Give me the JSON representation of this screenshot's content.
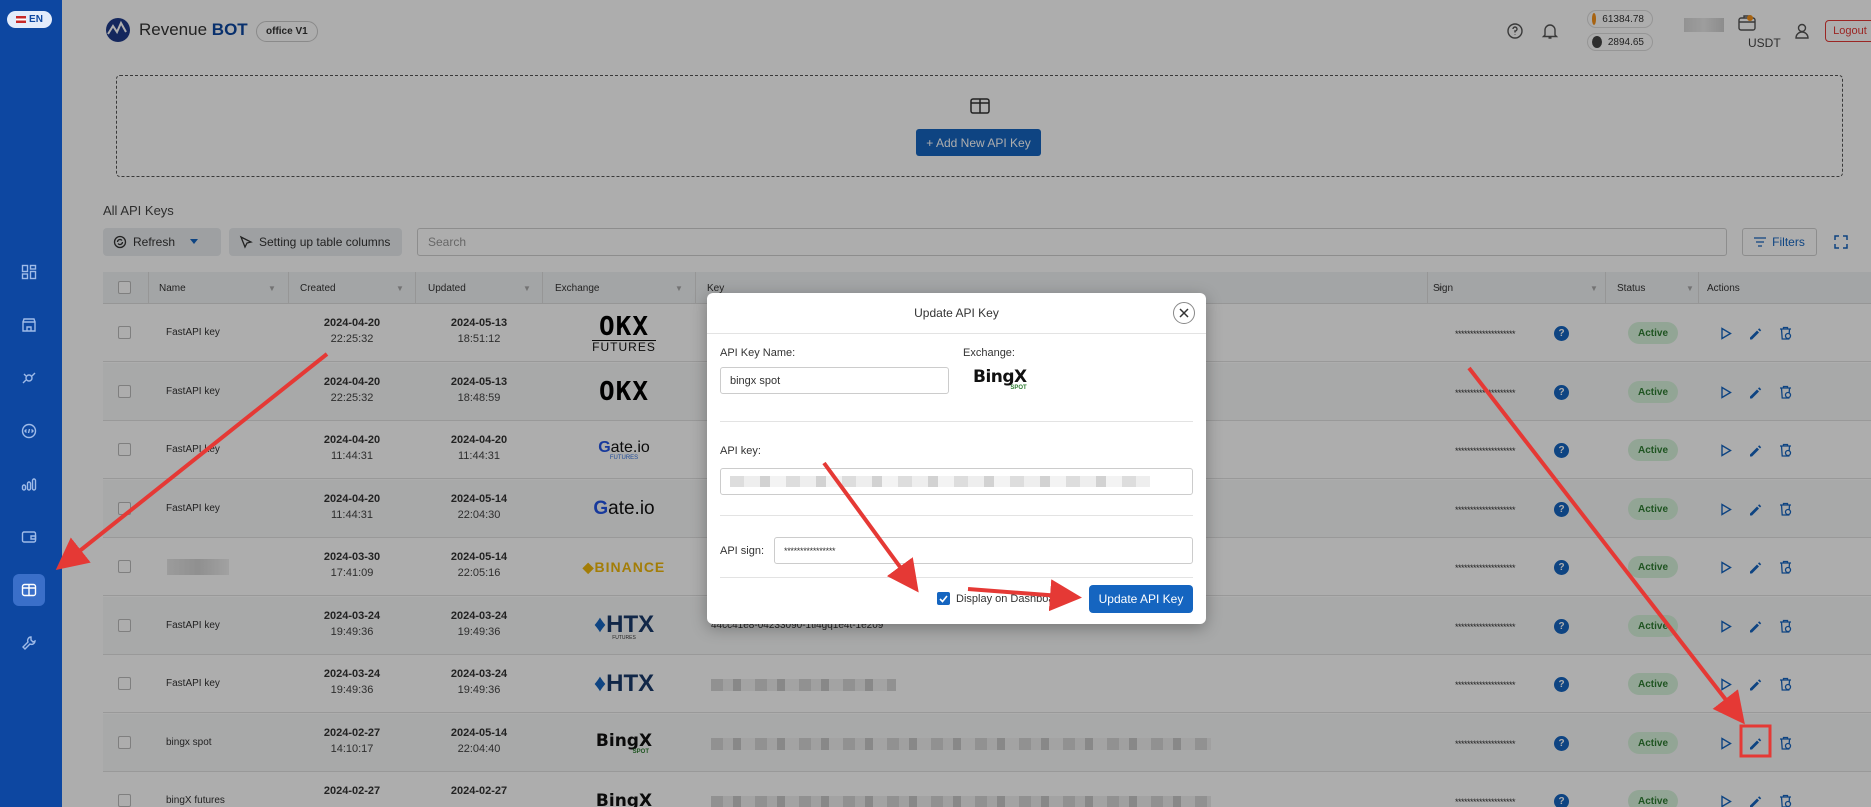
{
  "sidebar": {
    "lang": "EN",
    "icons": [
      "dashboard-icon",
      "store-icon",
      "bots-icon",
      "terminal-icon",
      "stats-icon",
      "wallet-icon",
      "api-keys-icon",
      "tools-icon"
    ]
  },
  "header": {
    "logo_plain": "Revenue",
    "logo_bold": "BOT",
    "office": "office V1",
    "btc_price": "61384.78",
    "eth_price": "2894.65",
    "currency": "USDT",
    "logout": "Logout"
  },
  "add_section": {
    "button": "+ Add New API Key"
  },
  "toolbar": {
    "section_title": "All API Keys",
    "refresh": "Refresh",
    "columns": "Setting up table columns",
    "search_placeholder": "Search",
    "filters": "Filters"
  },
  "table": {
    "columns": [
      "Name",
      "Created",
      "Updated",
      "Exchange",
      "Key",
      "Sign",
      "Status",
      "Actions"
    ],
    "rows": [
      {
        "name": "FastAPI key",
        "created_d": "2024-04-20",
        "created_t": "22:25:32",
        "updated_d": "2024-05-13",
        "updated_t": "18:51:12",
        "exchange": "OKX FUTURES",
        "key": "",
        "sign": "********************",
        "status": "Active"
      },
      {
        "name": "FastAPI key",
        "created_d": "2024-04-20",
        "created_t": "22:25:32",
        "updated_d": "2024-05-13",
        "updated_t": "18:48:59",
        "exchange": "OKX",
        "key": "",
        "sign": "********************",
        "status": "Active"
      },
      {
        "name": "FastAPI key",
        "created_d": "2024-04-20",
        "created_t": "11:44:31",
        "updated_d": "2024-04-20",
        "updated_t": "11:44:31",
        "exchange": "Gate.io FUTURES",
        "key": "",
        "sign": "********************",
        "status": "Active"
      },
      {
        "name": "FastAPI key",
        "created_d": "2024-04-20",
        "created_t": "11:44:31",
        "updated_d": "2024-05-14",
        "updated_t": "22:04:30",
        "exchange": "Gate.io",
        "key": "",
        "sign": "********************",
        "status": "Active"
      },
      {
        "name": "",
        "created_d": "2024-03-30",
        "created_t": "17:41:09",
        "updated_d": "2024-05-14",
        "updated_t": "22:05:16",
        "exchange": "BINANCE",
        "key": "",
        "sign": "********************",
        "status": "Active"
      },
      {
        "name": "FastAPI key",
        "created_d": "2024-03-24",
        "created_t": "19:49:36",
        "updated_d": "2024-03-24",
        "updated_t": "19:49:36",
        "exchange": "HTX FUTURES",
        "key": "44cc41e8-04233090-1tl4gq1e4t-1e209",
        "sign": "********************",
        "status": "Active"
      },
      {
        "name": "FastAPI key",
        "created_d": "2024-03-24",
        "created_t": "19:49:36",
        "updated_d": "2024-03-24",
        "updated_t": "19:49:36",
        "exchange": "HTX",
        "key": "",
        "sign": "********************",
        "status": "Active"
      },
      {
        "name": "bingx spot",
        "created_d": "2024-02-27",
        "created_t": "14:10:17",
        "updated_d": "2024-05-14",
        "updated_t": "22:04:40",
        "exchange": "BingX SPOT",
        "key": "",
        "sign": "********************",
        "status": "Active"
      },
      {
        "name": "bingX futures",
        "created_d": "2024-02-27",
        "created_t": "",
        "updated_d": "2024-02-27",
        "updated_t": "",
        "exchange": "BingX",
        "key": "",
        "sign": "********************",
        "status": "Active"
      }
    ]
  },
  "modal": {
    "title": "Update API Key",
    "name_label": "API Key Name:",
    "name_value": "bingx spot",
    "exchange_label": "Exchange:",
    "exchange_logo": "BingX",
    "exchange_sub": "SPOT",
    "key_label": "API key:",
    "sign_label": "API sign:",
    "sign_value": "****************",
    "checkbox_label": "Display on Dashboard",
    "update_button": "Update API Key"
  },
  "colors": {
    "primary": "#1565c0",
    "sidebar": "#0d47a1",
    "annotation": "#e53935",
    "active_badge": "#d8f3dc"
  }
}
